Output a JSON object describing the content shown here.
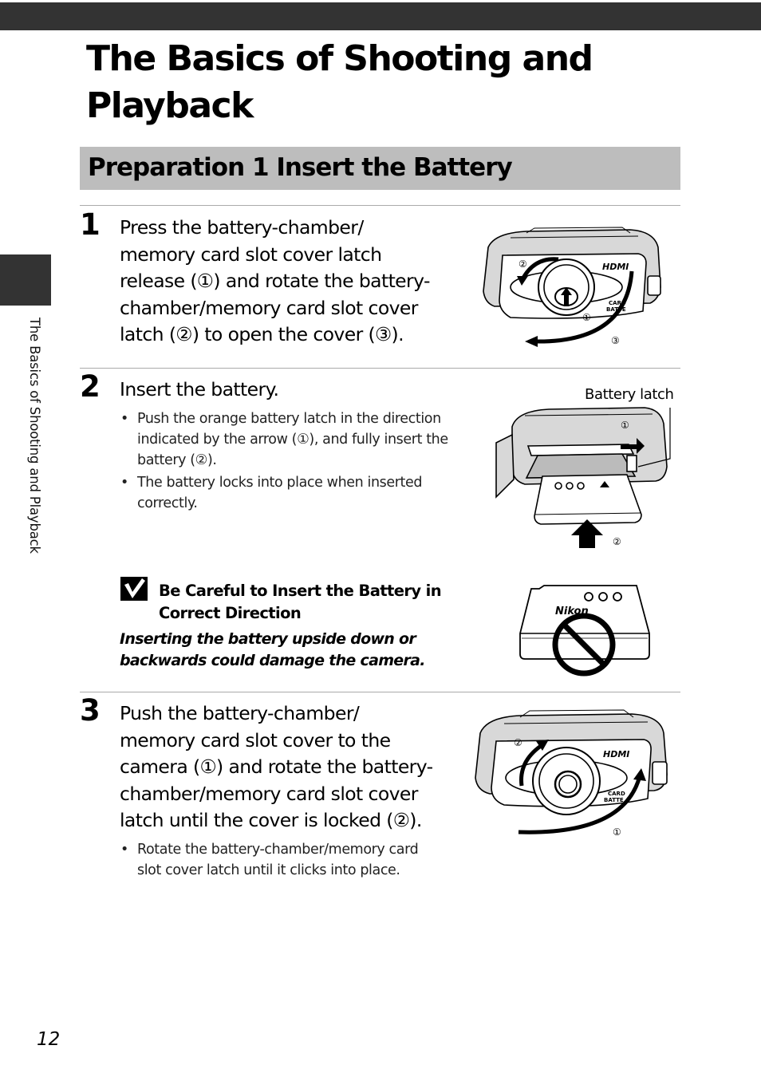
{
  "header": {
    "chapter_tab_label": "The Basics of Shooting and Playback"
  },
  "page_title": {
    "line1": "The Basics of Shooting and",
    "line2": "Playback"
  },
  "section": {
    "title": "Preparation 1 Insert the Battery"
  },
  "steps": [
    {
      "number": "1",
      "lines": [
        "Press the battery-chamber/",
        "memory card slot cover latch",
        "release (①) and rotate the battery-",
        "chamber/memory card slot cover",
        "latch (②) to open the cover (③)."
      ],
      "illustration": {
        "hdmi_label": "HDMI",
        "card_label": "CARD",
        "battery_label": "BATTE",
        "callouts": [
          "①",
          "②",
          "③"
        ]
      }
    },
    {
      "number": "2",
      "lines": [
        "Insert the battery."
      ],
      "bullets": [
        {
          "lines": [
            "Push the orange battery latch in the direction",
            "indicated by the arrow (①), and fully insert the",
            "battery (②)."
          ]
        },
        {
          "lines": [
            "The battery locks into place when inserted",
            "correctly."
          ]
        }
      ],
      "illustration": {
        "battery_latch_label": "Battery latch",
        "callouts": [
          "①",
          "②"
        ]
      }
    },
    {
      "number": "3",
      "lines": [
        "Push the battery-chamber/",
        "memory card slot cover to the",
        "camera (①) and rotate the battery-",
        "chamber/memory card slot cover",
        "latch until the cover is locked (②)."
      ],
      "bullets": [
        {
          "lines": [
            "Rotate the battery-chamber/memory card",
            "slot cover latch until it clicks into place."
          ]
        }
      ],
      "illustration": {
        "hdmi_label": "HDMI",
        "card_label": "CARD",
        "battery_label": "BATTE",
        "callouts": [
          "①",
          "②"
        ]
      }
    }
  ],
  "note": {
    "icon": "check-box-icon",
    "title_lines": [
      "Be Careful to Insert the Battery in",
      "Correct Direction"
    ],
    "body_lines": [
      "Inserting the battery upside down or",
      "backwards could damage the camera."
    ],
    "illustration": {
      "brand": "Nikon",
      "terminals": [
        "⊕",
        "Ⓣ",
        "⊖"
      ]
    }
  },
  "bullet_glyph": "•",
  "footer": {
    "page_number": "12"
  }
}
